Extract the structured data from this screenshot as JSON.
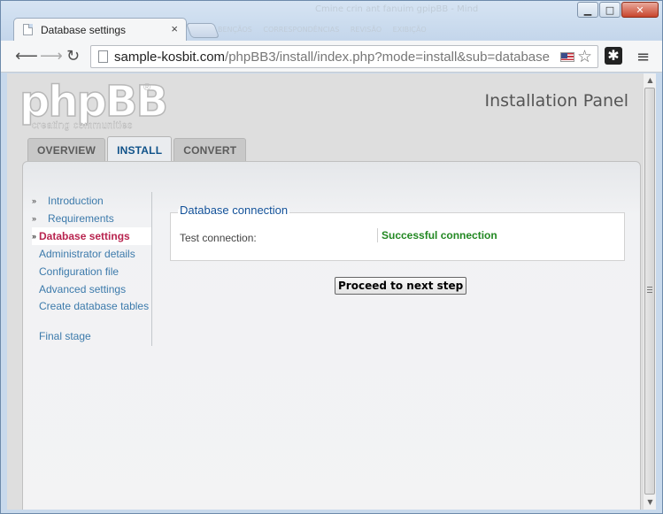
{
  "window": {
    "faded_title": "Cmine crin ant fanuim gpipBB - Mind",
    "faded_menu": "BENÇÃOS CORRESPONDÊNCIAS REVISÃO EXIBIÇÃO",
    "minimize_glyph": "▁",
    "maximize_glyph": "□",
    "close_glyph": "✕"
  },
  "tab": {
    "title": "Database settings",
    "close_glyph": "×"
  },
  "toolbar": {
    "back_glyph": "⟵",
    "forward_glyph": "⟶",
    "reload_glyph": "↻",
    "url_host": "sample-kosbit.com",
    "url_path": "/phpBB3/install/index.php?mode=install&sub=database",
    "star_glyph": "☆",
    "extension_glyph": "✱",
    "menu_glyph": "≡"
  },
  "header": {
    "logo_text": "phpBB",
    "logo_mark": "®",
    "logo_tagline": "creating  communities",
    "panel_title": "Installation Panel"
  },
  "panel_tabs": [
    {
      "label": "OVERVIEW",
      "active": false
    },
    {
      "label": "INSTALL",
      "active": true
    },
    {
      "label": "CONVERT",
      "active": false
    }
  ],
  "sidebar": {
    "items": [
      {
        "label": "Introduction",
        "state": "completed",
        "marker": "»"
      },
      {
        "label": "Requirements",
        "state": "completed",
        "marker": "»"
      },
      {
        "label": "Database settings",
        "state": "current",
        "marker": "»"
      },
      {
        "label": "Administrator details",
        "state": "pending"
      },
      {
        "label": "Configuration file",
        "state": "pending"
      },
      {
        "label": "Advanced settings",
        "state": "pending"
      },
      {
        "label": "Create database tables",
        "state": "pending"
      },
      {
        "label": "Final stage",
        "state": "pending"
      }
    ]
  },
  "main": {
    "legend": "Database connection",
    "field_label": "Test connection:",
    "field_value": "Successful connection",
    "proceed_label": "Proceed to next step"
  },
  "scrollbar": {
    "up_glyph": "▲",
    "down_glyph": "▼"
  },
  "colors": {
    "link": "#3c7aab",
    "current_step": "#b8244f",
    "legend": "#115098",
    "success": "#228822",
    "active_tab_text": "#105289"
  }
}
